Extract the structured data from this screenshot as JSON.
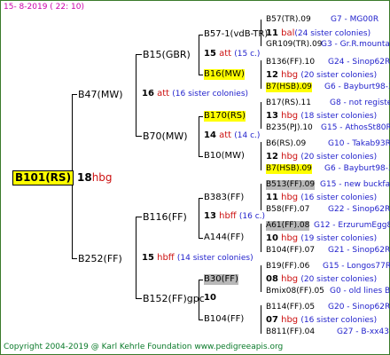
{
  "header": "15-  8-2019  ( 22: 10)",
  "root": {
    "name": "B101(RS)",
    "year": "18",
    "breed": "hbg"
  },
  "gen1": [
    {
      "name": "B47(MW)"
    },
    {
      "name": "B252(FF)"
    }
  ],
  "gen2": [
    {
      "name": "B15(GBR)",
      "year": "16",
      "breed": "att",
      "siblings": "(16 sister colonies)"
    },
    {
      "name": "B70(MW)",
      "year": "14",
      "breed": "att",
      "siblings": "(14 c.)"
    },
    {
      "name": "B116(FF)",
      "year": "13",
      "breed": "hbff",
      "siblings": "(16 c.)"
    },
    {
      "name": "B152(FF)gpc",
      "year": "10",
      "breed": "",
      "siblings": ""
    }
  ],
  "gen2_father": [
    {
      "name": "B57-1(vdB-TR)"
    },
    {
      "name": "B16(MW)"
    },
    {
      "name": "B170(RS)"
    },
    {
      "name": "B10(MW)"
    },
    {
      "name": "B383(FF)"
    },
    {
      "name": "A144(FF)"
    },
    {
      "name": "B30(FF)"
    },
    {
      "name": "B104(FF)"
    }
  ],
  "gen2_mid": {
    "year": "15",
    "breed": "hbff",
    "siblings": "(14 sister colonies)"
  },
  "gen3": [
    {
      "year": "15",
      "breed": "att",
      "siblings": "(15 c.)"
    },
    {
      "year": "12",
      "breed": "hbg",
      "siblings": "(20 sister colonies)"
    },
    {
      "year": "13",
      "breed": "hbg",
      "siblings": "(18 sister colonies)"
    },
    {
      "year": "12",
      "breed": "hbg",
      "siblings": "(20 sister colonies)"
    },
    {
      "year": "11",
      "breed": "hbg",
      "siblings": "(16 sister colonies)"
    },
    {
      "year": "10",
      "breed": "hbg",
      "siblings": "(19 sister colonies)"
    },
    {
      "year": "08",
      "breed": "hbg",
      "siblings": "(20 sister colonies)"
    },
    {
      "year": "07",
      "breed": "hbg",
      "siblings": "(16 sister colonies)"
    }
  ],
  "gen3_top": {
    "year": "11",
    "breed": "bal",
    "siblings": "(24 sister colonies)"
  },
  "gen4": [
    {
      "name": "B57(TR).09",
      "info": "G7 - MG00R"
    },
    {
      "name": "GR109(TR).09",
      "info": "G3 - Gr.R.mounta"
    },
    {
      "name": "B136(FF).10",
      "info": "G24 - Sinop62R"
    },
    {
      "name": "B7(HSB).09",
      "info": "G6 - Bayburt98-3"
    },
    {
      "name": "B17(RS).11",
      "info": "G8 - not registe"
    },
    {
      "name": "B235(PJ).10",
      "info": "G15 - AthosSt80R"
    },
    {
      "name": "B6(RS).09",
      "info": "G10 - Takab93R"
    },
    {
      "name": "B7(HSB).09",
      "info": "G6 - Bayburt98-3"
    },
    {
      "name": "B513(FF).09",
      "info": "G15 - new buckfas"
    },
    {
      "name": "B58(FF).07",
      "info": "G22 - Sinop62R"
    },
    {
      "name": "A61(FF).08",
      "info": "G12 - ErzurumEgg8"
    },
    {
      "name": "B104(FF).07",
      "info": "G21 - Sinop62R"
    },
    {
      "name": "B19(FF).06",
      "info": "G15 - Longos77R"
    },
    {
      "name": "Bmix08(FF).05",
      "info": "G0 - old lines B"
    },
    {
      "name": "B114(FF).05",
      "info": "G20 - Sinop62R"
    },
    {
      "name": "B811(FF).04",
      "info": "G27 - B-xx43"
    }
  ],
  "footer": "Copyright 2004-2019 @ Karl Kehrle Foundation    www.pedigreeapis.org"
}
